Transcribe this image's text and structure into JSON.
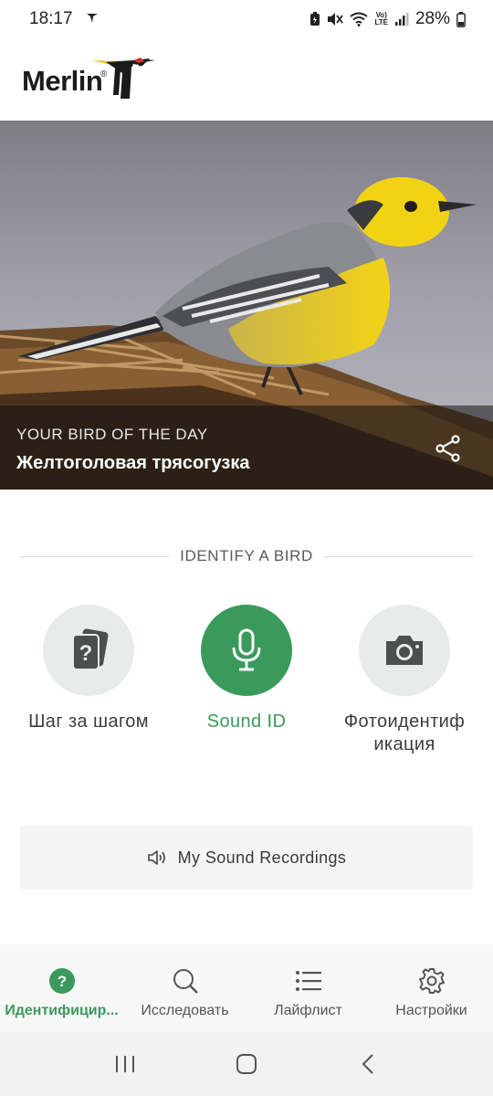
{
  "status_bar": {
    "time": "18:17",
    "battery": "28%",
    "network": "LTE",
    "icons": [
      "location-arrow-icon",
      "battery-saver-icon",
      "mute-icon",
      "wifi-icon",
      "volte-icon",
      "signal-icon",
      "battery-icon"
    ]
  },
  "header": {
    "logo_text": "Merlin",
    "logo_mark": "®"
  },
  "hero": {
    "kicker": "YOUR BIRD OF THE DAY",
    "bird_name": "Желтоголовая трясогузка",
    "share_icon": "share-icon"
  },
  "identify": {
    "section_label": "IDENTIFY A BIRD",
    "options": [
      {
        "label": "Шаг за шагом",
        "icon": "step-by-step-cards-icon",
        "active": false
      },
      {
        "label": "Sound ID",
        "icon": "microphone-icon",
        "active": true
      },
      {
        "label": "Фотоидентиф икация",
        "icon": "camera-icon",
        "active": false
      }
    ],
    "recordings_label": "My Sound Recordings",
    "recordings_icon": "speaker-icon"
  },
  "bottom_nav": {
    "items": [
      {
        "label": "Идентифицир...",
        "icon": "help-circle-icon",
        "active": true
      },
      {
        "label": "Исследовать",
        "icon": "search-icon",
        "active": false
      },
      {
        "label": "Лайфлист",
        "icon": "list-icon",
        "active": false
      },
      {
        "label": "Настройки",
        "icon": "gear-icon",
        "active": false
      }
    ]
  },
  "colors": {
    "accent": "#3a9a5b",
    "icon_circle": "#e7ebe9",
    "nav_background": "#f6f7f6"
  }
}
